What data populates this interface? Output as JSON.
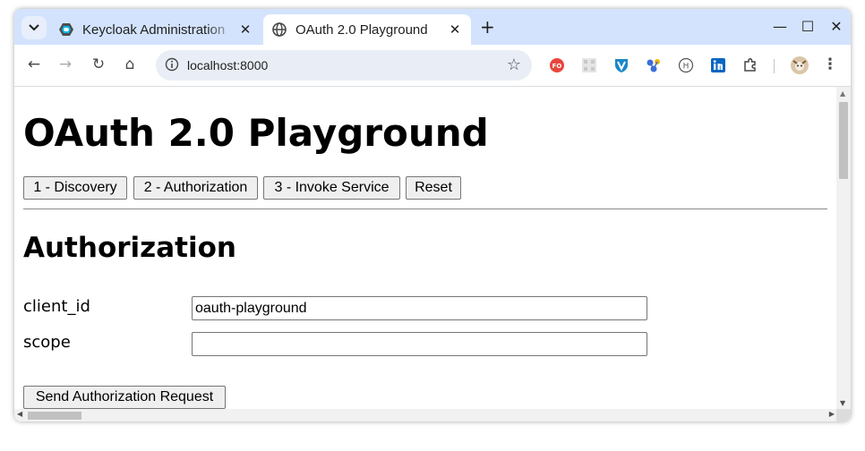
{
  "browser": {
    "tabs": [
      {
        "title": "Keycloak Administration",
        "close": "✕",
        "active": false
      },
      {
        "title": "OAuth 2.0 Playground",
        "close": "✕",
        "active": true
      }
    ],
    "new_tab": "+",
    "window_controls": {
      "minimize": "—",
      "maximize": "☐",
      "close": "✕"
    },
    "address": "localhost:8000",
    "nav": {
      "back": "←",
      "forward": "→",
      "reload": "↻",
      "home": "⌂"
    },
    "star": "☆",
    "menu": "⋮",
    "extensions": [
      "fo-extension-icon",
      "grid-extension-icon",
      "shield-v-extension-icon",
      "network-extension-icon",
      "h-circle-extension-icon",
      "linkedin-extension-icon",
      "puzzle-extension-icon"
    ],
    "accent": "#d3e3fd"
  },
  "page": {
    "title": "OAuth 2.0 Playground",
    "buttons": {
      "discovery": "1 - Discovery",
      "authorization": "2 - Authorization",
      "invoke": "3 - Invoke Service",
      "reset": "Reset"
    },
    "section_title": "Authorization",
    "form": {
      "client_id_label": "client_id",
      "client_id_value": "oauth-playground",
      "scope_label": "scope",
      "scope_value": "",
      "submit": "Send Authorization Request"
    }
  }
}
